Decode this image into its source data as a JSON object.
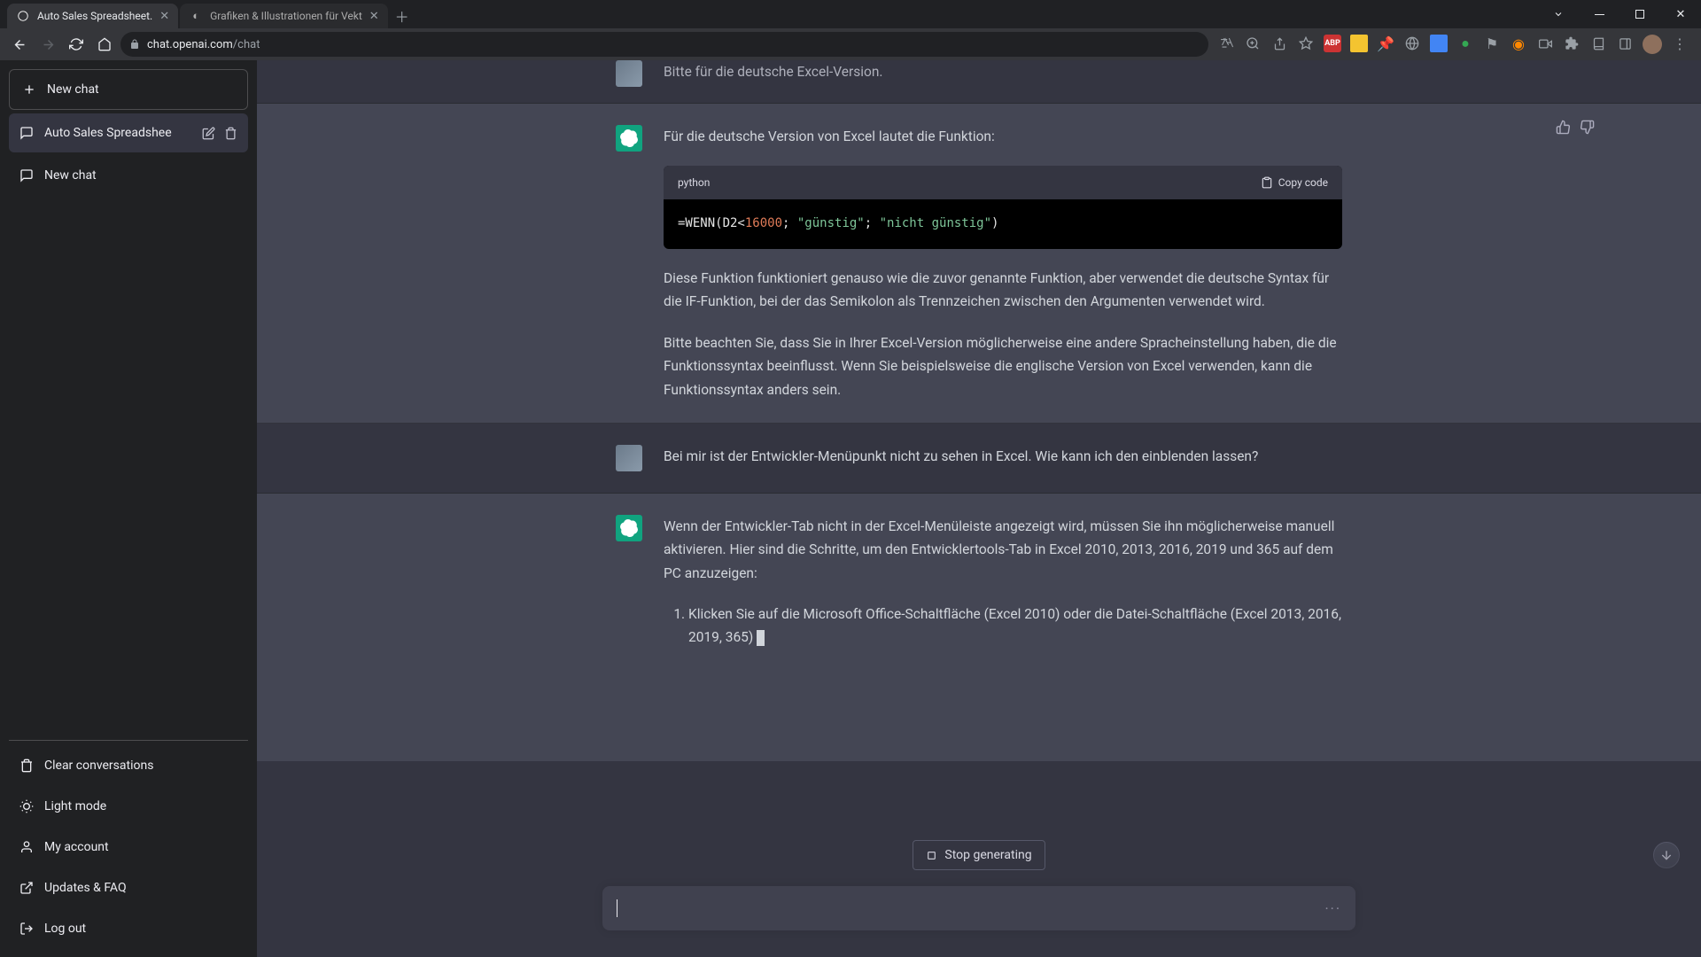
{
  "browser": {
    "tabs": [
      {
        "title": "Auto Sales Spreadsheet.",
        "active": true,
        "favicon": "openai"
      },
      {
        "title": "Grafiken & Illustrationen für Vekt",
        "active": false,
        "favicon": "dark"
      }
    ],
    "url_prefix": "chat.openai.com",
    "url_path": "/chat"
  },
  "sidebar": {
    "new_chat": "New chat",
    "chats": [
      {
        "label": "Auto Sales Spreadshee",
        "active": true
      },
      {
        "label": "New chat",
        "active": false
      }
    ],
    "footer": {
      "clear": "Clear conversations",
      "light": "Light mode",
      "account": "My account",
      "updates": "Updates & FAQ",
      "logout": "Log out"
    }
  },
  "conversation": {
    "partial_user_text": "Bitte für die deutsche Excel-Version.",
    "assistant1": {
      "intro": "Für die deutsche Version von Excel lautet die Funktion:",
      "code_lang": "python",
      "copy_label": "Copy code",
      "code": {
        "prefix": "=WENN(D2<",
        "num": "16000",
        "mid1": "; ",
        "str1": "\"günstig\"",
        "mid2": "; ",
        "str2": "\"nicht günstig\"",
        "suffix": ")"
      },
      "para2": "Diese Funktion funktioniert genauso wie die zuvor genannte Funktion, aber verwendet die deutsche Syntax für die IF-Funktion, bei der das Semikolon als Trennzeichen zwischen den Argumenten verwendet wird.",
      "para3": "Bitte beachten Sie, dass Sie in Ihrer Excel-Version möglicherweise eine andere Spracheinstellung haben, die die Funktionssyntax beeinflusst. Wenn Sie beispielsweise die englische Version von Excel verwenden, kann die Funktionssyntax anders sein."
    },
    "user2": "Bei mir ist der Entwickler-Menüpunkt nicht zu sehen in Excel. Wie kann ich den einblenden lassen?",
    "assistant2": {
      "para1": "Wenn der Entwickler-Tab nicht in der Excel-Menüleiste angezeigt wird, müssen Sie ihn möglicherweise manuell aktivieren. Hier sind die Schritte, um den Entwicklertools-Tab in Excel 2010, 2013, 2016, 2019 und 365 auf dem PC anzuzeigen:",
      "list_item1": "Klicken Sie auf die Microsoft Office-Schaltfläche (Excel 2010) oder die Datei-Schaltfläche (Excel 2013, 2016, 2019, 365)"
    }
  },
  "controls": {
    "stop_generating": "Stop generating"
  }
}
